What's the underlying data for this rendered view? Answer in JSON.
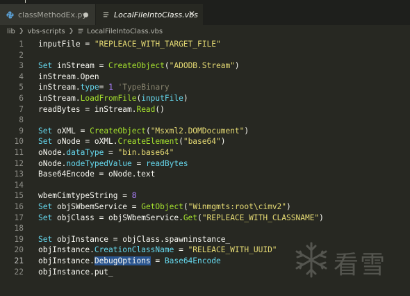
{
  "tabs": [
    {
      "label": "classMethodEx.py",
      "active": false,
      "modified": true,
      "icon": "python-icon"
    },
    {
      "label": "LocalFileIntoClass.vbs",
      "active": true,
      "modified": false,
      "icon": "vbs-file-icon"
    }
  ],
  "breadcrumb": [
    "lib",
    "vbs-scripts",
    "LocalFileIntoClass.vbs"
  ],
  "current_line": 21,
  "lines": [
    {
      "n": "1",
      "tokens": [
        [
          "t",
          "inputFile = "
        ],
        [
          "str",
          "\"REPLEACE_WITH_TARGET_FILE\""
        ]
      ]
    },
    {
      "n": "2",
      "tokens": []
    },
    {
      "n": "3",
      "tokens": [
        [
          "kw",
          "Set"
        ],
        [
          "t",
          " inStream = "
        ],
        [
          "fn",
          "CreateObject"
        ],
        [
          "t",
          "("
        ],
        [
          "str",
          "\"ADODB.Stream\""
        ],
        [
          "t",
          ")"
        ]
      ]
    },
    {
      "n": "4",
      "tokens": [
        [
          "t",
          "inStream.Open"
        ]
      ]
    },
    {
      "n": "5",
      "tokens": [
        [
          "t",
          "inStream."
        ],
        [
          "kw",
          "type"
        ],
        [
          "t",
          "= "
        ],
        [
          "num",
          "1"
        ],
        [
          "t",
          " "
        ],
        [
          "cm",
          "'TypeBinary"
        ]
      ]
    },
    {
      "n": "6",
      "tokens": [
        [
          "t",
          "inStream."
        ],
        [
          "fn",
          "LoadFromFile"
        ],
        [
          "t",
          "("
        ],
        [
          "kw",
          "inputFile"
        ],
        [
          "t",
          ")"
        ]
      ]
    },
    {
      "n": "7",
      "tokens": [
        [
          "t",
          "readBytes = inStream."
        ],
        [
          "fn",
          "Read"
        ],
        [
          "t",
          "()"
        ]
      ]
    },
    {
      "n": "8",
      "tokens": []
    },
    {
      "n": "9",
      "tokens": [
        [
          "kw",
          "Set"
        ],
        [
          "t",
          " oXML = "
        ],
        [
          "fn",
          "CreateObject"
        ],
        [
          "t",
          "("
        ],
        [
          "str",
          "\"Msxml2.DOMDocument\""
        ],
        [
          "t",
          ")"
        ]
      ]
    },
    {
      "n": "10",
      "tokens": [
        [
          "kw",
          "Set"
        ],
        [
          "t",
          " oNode = oXML."
        ],
        [
          "fn",
          "CreateElement"
        ],
        [
          "t",
          "("
        ],
        [
          "str",
          "\"base64\""
        ],
        [
          "t",
          ")"
        ]
      ]
    },
    {
      "n": "11",
      "tokens": [
        [
          "t",
          "oNode."
        ],
        [
          "kw",
          "dataType"
        ],
        [
          "t",
          " = "
        ],
        [
          "str",
          "\"bin.base64\""
        ]
      ]
    },
    {
      "n": "12",
      "tokens": [
        [
          "t",
          "oNode."
        ],
        [
          "kw",
          "nodeTypedValue"
        ],
        [
          "t",
          " = "
        ],
        [
          "kw",
          "readBytes"
        ]
      ]
    },
    {
      "n": "13",
      "tokens": [
        [
          "t",
          "Base64Encode = oNode.text"
        ]
      ]
    },
    {
      "n": "14",
      "tokens": []
    },
    {
      "n": "15",
      "tokens": [
        [
          "t",
          "wbemCimtypeString = "
        ],
        [
          "num",
          "8"
        ]
      ]
    },
    {
      "n": "16",
      "tokens": [
        [
          "kw",
          "Set"
        ],
        [
          "t",
          " objSWbemService = "
        ],
        [
          "fn",
          "GetObject"
        ],
        [
          "t",
          "("
        ],
        [
          "str",
          "\"Winmgmts:root\\cimv2\""
        ],
        [
          "t",
          ")"
        ]
      ]
    },
    {
      "n": "17",
      "tokens": [
        [
          "kw",
          "Set"
        ],
        [
          "t",
          " objClass = objSWbemService."
        ],
        [
          "fn",
          "Get"
        ],
        [
          "t",
          "("
        ],
        [
          "str",
          "\"REPLEACE_WITH_CLASSNAME\""
        ],
        [
          "t",
          ")"
        ]
      ]
    },
    {
      "n": "18",
      "tokens": []
    },
    {
      "n": "19",
      "tokens": [
        [
          "kw",
          "Set"
        ],
        [
          "t",
          " objInstance = objClass.spawninstance_"
        ]
      ]
    },
    {
      "n": "20",
      "tokens": [
        [
          "t",
          "objInstance."
        ],
        [
          "kw",
          "CreationClassName"
        ],
        [
          "t",
          " = "
        ],
        [
          "str",
          "\"RELEACE_WITH_UUID\""
        ]
      ]
    },
    {
      "n": "21",
      "tokens": [
        [
          "t",
          "objInstance."
        ],
        [
          "sel",
          "DebugOptions"
        ],
        [
          "t",
          " = "
        ],
        [
          "kw",
          "Base64Encode"
        ]
      ]
    },
    {
      "n": "22",
      "tokens": [
        [
          "t",
          "objInstance.put_"
        ]
      ]
    }
  ],
  "watermark": {
    "text": "看雪",
    "icon": "snowflake-icon"
  },
  "colors": {
    "background": "#272822",
    "keyword": "#66d9ef",
    "string": "#e6db74",
    "number": "#ae81ff",
    "comment": "#88846f",
    "function": "#a6e22e",
    "selection": "#2a5590"
  }
}
